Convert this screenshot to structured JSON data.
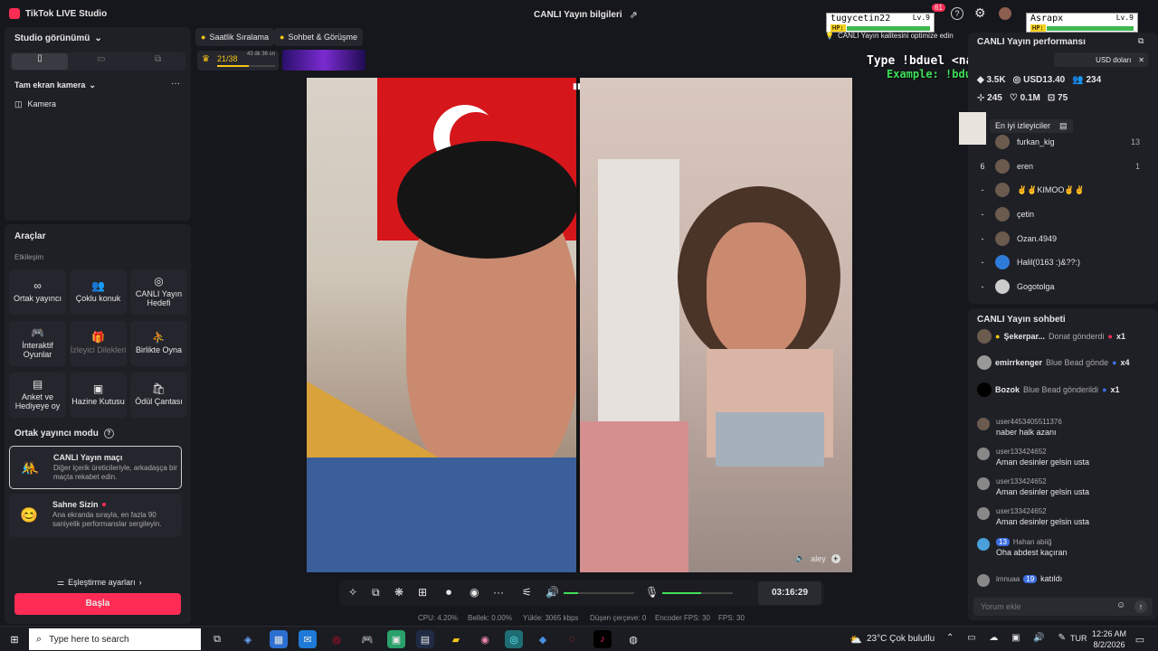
{
  "app": {
    "title": "TikTok LIVE Studio",
    "center_title": "CANLI Yayın bilgileri",
    "notif_count": "61"
  },
  "overlays": {
    "left_badge": {
      "name": "tugycetin22",
      "lv": "Lv.9",
      "hp": "HP:"
    },
    "right_badge": {
      "name": "Asrapx",
      "lv": "Lv.9",
      "hp": "HP:"
    },
    "type_line": "Type !bduel <name> to play",
    "example_line": "Example: !bduel Asrapx"
  },
  "left": {
    "studio_view": "Studio görünümü",
    "camera_section": "Tam ekran kamera",
    "camera_item": "Kamera",
    "tools_title": "Araçlar",
    "interaction": "Etkileşim",
    "tools": [
      {
        "label": "Ortak yayıncı",
        "icon": "link-icon"
      },
      {
        "label": "Çoklu konuk",
        "icon": "users-icon"
      },
      {
        "label": "CANLI Yayın Hedefi",
        "icon": "target-icon"
      },
      {
        "label": "İnteraktif Oyunlar",
        "icon": "gamepad-icon"
      },
      {
        "label": "İzleyici Dilekleri",
        "icon": "gift-icon"
      },
      {
        "label": "Birlikte Oyna",
        "icon": "play-icon"
      },
      {
        "label": "Anket ve Hediyeye oy",
        "icon": "poll-icon"
      },
      {
        "label": "Hazine Kutusu",
        "icon": "chest-icon"
      },
      {
        "label": "Ödül Çantası",
        "icon": "bag-icon"
      }
    ],
    "cohost_mode": "Ortak yayıncı modu",
    "match_title": "CANLI Yayın maçı",
    "match_desc": "Diğer içerik üreticileriyle, arkadaşça bir maçta rekabet edin.",
    "stage_title": "Sahne Sizin",
    "stage_desc": "Ana ekranda sırayla, en fazla 90 saniyelik performanslar sergileyin.",
    "match_settings": "Eşleştirme ayarları",
    "main_button": "Başla"
  },
  "center": {
    "chip_hourly": "Saatlik Sıralama",
    "chip_chat": "Sohbet & Görüşme",
    "rank": "21/38",
    "rank_time": "43 dk 36 sn",
    "quality_tip": "CANLI Yayın kalitesini optimize edin",
    "guest_name": "aley",
    "timer": "03:16:29",
    "stats": [
      {
        "label": "CPU:",
        "value": "4.20%"
      },
      {
        "label": "Bellek:",
        "value": "0.00%"
      },
      {
        "label": "Yükle:",
        "value": "3065 kbps"
      },
      {
        "label": "Düşen çerçeve:",
        "value": "0"
      },
      {
        "label": "Encoder FPS:",
        "value": "30"
      },
      {
        "label": "FPS:",
        "value": "30"
      }
    ],
    "mic_volume": 0.55,
    "speaker_volume": 0.2
  },
  "right": {
    "perf_title": "CANLI Yayın performansı",
    "perf_tip": "USD doları",
    "metrics": [
      "3.5K",
      "USD13.40",
      "234",
      "245",
      "0.1M",
      "75"
    ],
    "top_viewers": "En iyi izleyiciler",
    "viewers": [
      {
        "rank": "",
        "name": "furkan_kig",
        "count": "13"
      },
      {
        "rank": "6",
        "name": "eren",
        "count": "1"
      },
      {
        "rank": "-",
        "name": "✌️✌️KIMOO✌️✌️",
        "count": ""
      },
      {
        "rank": "-",
        "name": "çetin",
        "count": ""
      },
      {
        "rank": "-",
        "name": "Ozan.4949",
        "count": ""
      },
      {
        "rank": "-",
        "name": "Halil(0163 :)&??:)",
        "count": ""
      },
      {
        "rank": "-",
        "name": "Gogotolga",
        "count": ""
      }
    ],
    "chat_title": "CANLI Yayın sohbeti",
    "gifts": [
      {
        "user": "Şekerpar...",
        "text": "Donat gönderdi",
        "count": "x1"
      },
      {
        "user": "emirrkenger",
        "text": "Blue Bead gönde",
        "count": "x4"
      },
      {
        "user": "Bozok",
        "text": "Blue Bead gönderildi",
        "count": "x1"
      }
    ],
    "messages": [
      {
        "user": "user4453405511376",
        "text": "naber halk azanı"
      },
      {
        "user": "user133424652",
        "text": "Aman desinler gelsin usta"
      },
      {
        "user": "user133424652",
        "text": "Aman desinler gelsin usta"
      },
      {
        "user": "user133424652",
        "text": "Aman desinler gelsin usta"
      },
      {
        "user": "Hahan abiiğ",
        "badge": "13",
        "text": "Oha abdest kaçıran"
      },
      {
        "user": "imnuaa",
        "badge": "19",
        "text": "katıldı"
      }
    ],
    "comment_placeholder": "Yorum ekle"
  },
  "taskbar": {
    "search": "Type here to search",
    "weather": "23°C  Çok bulutlu",
    "lang": "TUR",
    "time": "12:26 AM",
    "date": "8/2/2026"
  }
}
